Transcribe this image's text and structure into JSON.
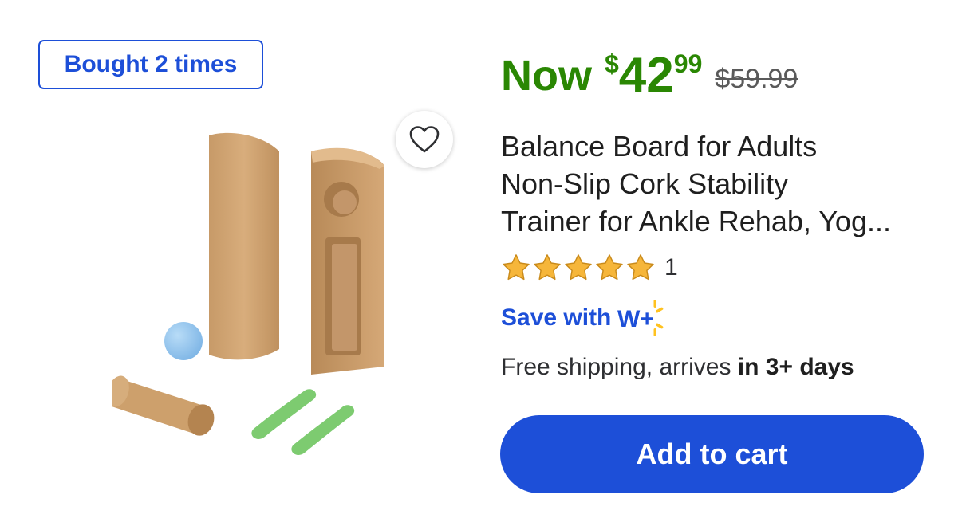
{
  "badge": {
    "label": "Bought 2 times"
  },
  "price": {
    "now_label": "Now",
    "currency": "$",
    "dollars": "42",
    "cents": "99",
    "was": "$59.99"
  },
  "product": {
    "title_lines": [
      "Balance Board for Adults",
      "Non-Slip Cork Stability",
      "Trainer for Ankle Rehab, Yog..."
    ],
    "rating": {
      "stars": 5,
      "max": 5,
      "count": "1"
    }
  },
  "membership": {
    "save_label": "Save with",
    "logo_text": "W+"
  },
  "shipping": {
    "text": "Free shipping, arrives ",
    "emphasis": "in 3+ days"
  },
  "actions": {
    "add_to_cart": "Add to cart"
  },
  "colors": {
    "brand_blue": "#1d4fd8",
    "price_green": "#2a8703",
    "star_gold": "#f6b63a",
    "spark_yellow": "#ffc220"
  },
  "icons": {
    "favorite": "heart-outline-icon",
    "rating": "star-icon"
  }
}
